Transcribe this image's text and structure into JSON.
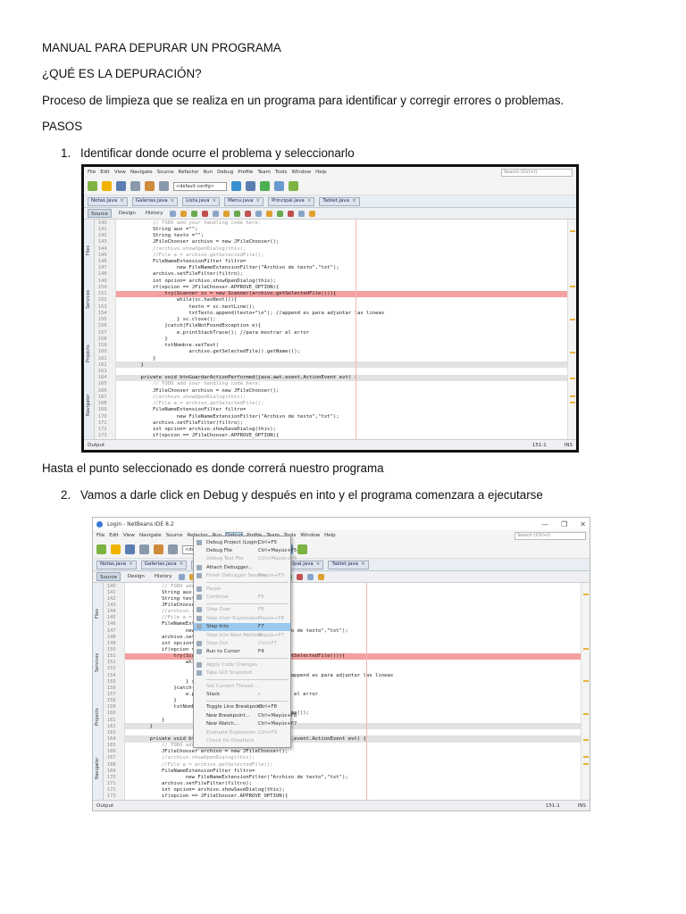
{
  "doc": {
    "title": "MANUAL PARA DEPURAR UN PROGRAMA",
    "question": "¿QUÉ ES LA DEPURACIÓN?",
    "definition": "Proceso de limpieza que se realiza en un programa para identificar y corregir errores o problemas.",
    "steps_heading": "PASOS",
    "step1_num": "1.",
    "step1": "Identificar donde ocurre el problema y seleccionarlo",
    "note": "Hasta el punto seleccionado es donde correrá nuestro programa",
    "step2_num": "2.",
    "step2": "Vamos a darle click en Debug y después en into y el programa comenzara a ejecutarse"
  },
  "ide": {
    "window_title": "Login - NetBeans IDE 8.2",
    "menus": [
      "File",
      "Edit",
      "View",
      "Navigate",
      "Source",
      "Refactor",
      "Run",
      "Debug",
      "Profile",
      "Team",
      "Tools",
      "Window",
      "Help"
    ],
    "search_placeholder": "Search (Ctrl+I)",
    "config": "<default config>",
    "file_tabs": [
      "Notas.java",
      "Galerias.java",
      "Lista.java",
      "Menu.java",
      "Principal.java",
      "Tablet.java"
    ],
    "editor_tabs": [
      "Source",
      "Design",
      "History"
    ],
    "side_panels": [
      "Files",
      "Services",
      "Projects",
      "Navigator"
    ],
    "status_bar": {
      "output": "Output",
      "position": "151:1",
      "mode": "INS"
    },
    "code": [
      {
        "n": "140",
        "t": "        // TODO add your handling code here:",
        "k": "comment"
      },
      {
        "n": "141",
        "t": "        String aux =\"\";"
      },
      {
        "n": "142",
        "t": "        String texto =\"\";"
      },
      {
        "n": "143",
        "t": "        JFileChooser archivo = new JFileChooser();"
      },
      {
        "n": "144",
        "t": "        //archivo.showOpenDialog(this);",
        "k": "comment"
      },
      {
        "n": "145",
        "t": "        //File a = archivo.getSelectedFile();",
        "k": "comment"
      },
      {
        "n": "146",
        "t": "        FileNameExtensionFilter filtro="
      },
      {
        "n": "147",
        "t": "                new FileNameExtensionFilter(\"Archivo de texto\",\"txt\");"
      },
      {
        "n": "148",
        "t": "        archivo.setFileFilter(filtro);"
      },
      {
        "n": "149",
        "t": "        int opcion= archivo.showOpenDialog(this);"
      },
      {
        "n": "150",
        "t": "        if(opcion == JFileChooser.APPROVE_OPTION){"
      },
      {
        "n": "151",
        "t": "            try(Scanner sc = new Scanner(archivo.getSelectedFile())){",
        "k": "bp"
      },
      {
        "n": "152",
        "t": "                while(sc.hasNext()){"
      },
      {
        "n": "153",
        "t": "                    texto = sc.nextLine();"
      },
      {
        "n": "154",
        "t": "                    txtTexto.append(texto+\"\\n\"); //append es para adjuntar las lineas"
      },
      {
        "n": "155",
        "t": "                } sc.close();"
      },
      {
        "n": "156",
        "t": "            }catch(FileNotFoundException e){"
      },
      {
        "n": "157",
        "t": "                e.printStackTrace(); //para mostrar el error"
      },
      {
        "n": "158",
        "t": "            }"
      },
      {
        "n": "159",
        "t": "            txtNombre.setText("
      },
      {
        "n": "160",
        "t": "                    archivo.getSelectedFile().getName());"
      },
      {
        "n": "161",
        "t": "        }"
      },
      {
        "n": "162",
        "t": "    }",
        "k": "gray"
      },
      {
        "n": "163",
        "t": ""
      },
      {
        "n": "164",
        "t": "    private void btnGuardarActionPerformed(java.awt.event.ActionEvent evt) {",
        "k": "gray"
      },
      {
        "n": "165",
        "t": "        // TODO add your handling code here:",
        "k": "comment"
      },
      {
        "n": "166",
        "t": "        JFileChooser archivo = new JFileChooser();"
      },
      {
        "n": "167",
        "t": "        //archivo.showOpenDialog(this);",
        "k": "comment"
      },
      {
        "n": "168",
        "t": "        //File a = archivo.getSelectedFile();",
        "k": "comment"
      },
      {
        "n": "169",
        "t": "        FileNameExtensionFilter filtro="
      },
      {
        "n": "170",
        "t": "                new FileNameExtensionFilter(\"Archivo de texto\",\"txt\");"
      },
      {
        "n": "171",
        "t": "        archivo.setFileFilter(filtro);"
      },
      {
        "n": "172",
        "t": "        int opcion= archivo.showSaveDialog(this);"
      },
      {
        "n": "173",
        "t": "        if(opcion == JFileChooser.APPROVE_OPTION){"
      }
    ],
    "debug_menu": [
      {
        "l": "Debug Project (Login)",
        "k": "Ctrl+F5",
        "icon": true
      },
      {
        "l": "Debug File",
        "k": "Ctrl+Mayús+F5"
      },
      {
        "l": "Debug Test File",
        "k": "Ctrl+Mayús+F6",
        "dis": true
      },
      {
        "l": "Attach Debugger...",
        "icon": true
      },
      {
        "l": "Finish Debugger Session",
        "k": "Mayús+F5",
        "dis": true,
        "icon": true
      },
      {
        "sep": true
      },
      {
        "l": "Pause",
        "dis": true,
        "icon": true
      },
      {
        "l": "Continue",
        "k": "F5",
        "dis": true,
        "icon": true
      },
      {
        "sep": true
      },
      {
        "l": "Step Over",
        "k": "F8",
        "dis": true,
        "icon": true
      },
      {
        "l": "Step Over Expression",
        "k": "Mayús+F8",
        "dis": true,
        "icon": true
      },
      {
        "l": "Step Into",
        "k": "F7",
        "hl": true,
        "icon": true
      },
      {
        "l": "Step Into Next Method",
        "k": "Mayús+F7",
        "dis": true
      },
      {
        "l": "Step Out",
        "k": "Ctrl+F7",
        "dis": true,
        "icon": true
      },
      {
        "l": "Run to Cursor",
        "k": "F4",
        "icon": true
      },
      {
        "sep": true
      },
      {
        "l": "Apply Code Changes",
        "dis": true,
        "icon": true
      },
      {
        "l": "Take GUI Snapshot",
        "dis": true,
        "icon": true
      },
      {
        "sep": true
      },
      {
        "l": "Set Current Thread...",
        "dis": true
      },
      {
        "l": "Stack",
        "k": "›"
      },
      {
        "sep": true
      },
      {
        "l": "Toggle Line Breakpoint",
        "k": "Ctrl+F8"
      },
      {
        "l": "New Breakpoint...",
        "k": "Ctrl+Mayús+F8"
      },
      {
        "l": "New Watch...",
        "k": "Ctrl+Mayús+F7"
      },
      {
        "l": "Evaluate Expression...",
        "k": "Ctrl+F9",
        "dis": true
      },
      {
        "l": "Check for Deadlock",
        "dis": true
      }
    ]
  }
}
